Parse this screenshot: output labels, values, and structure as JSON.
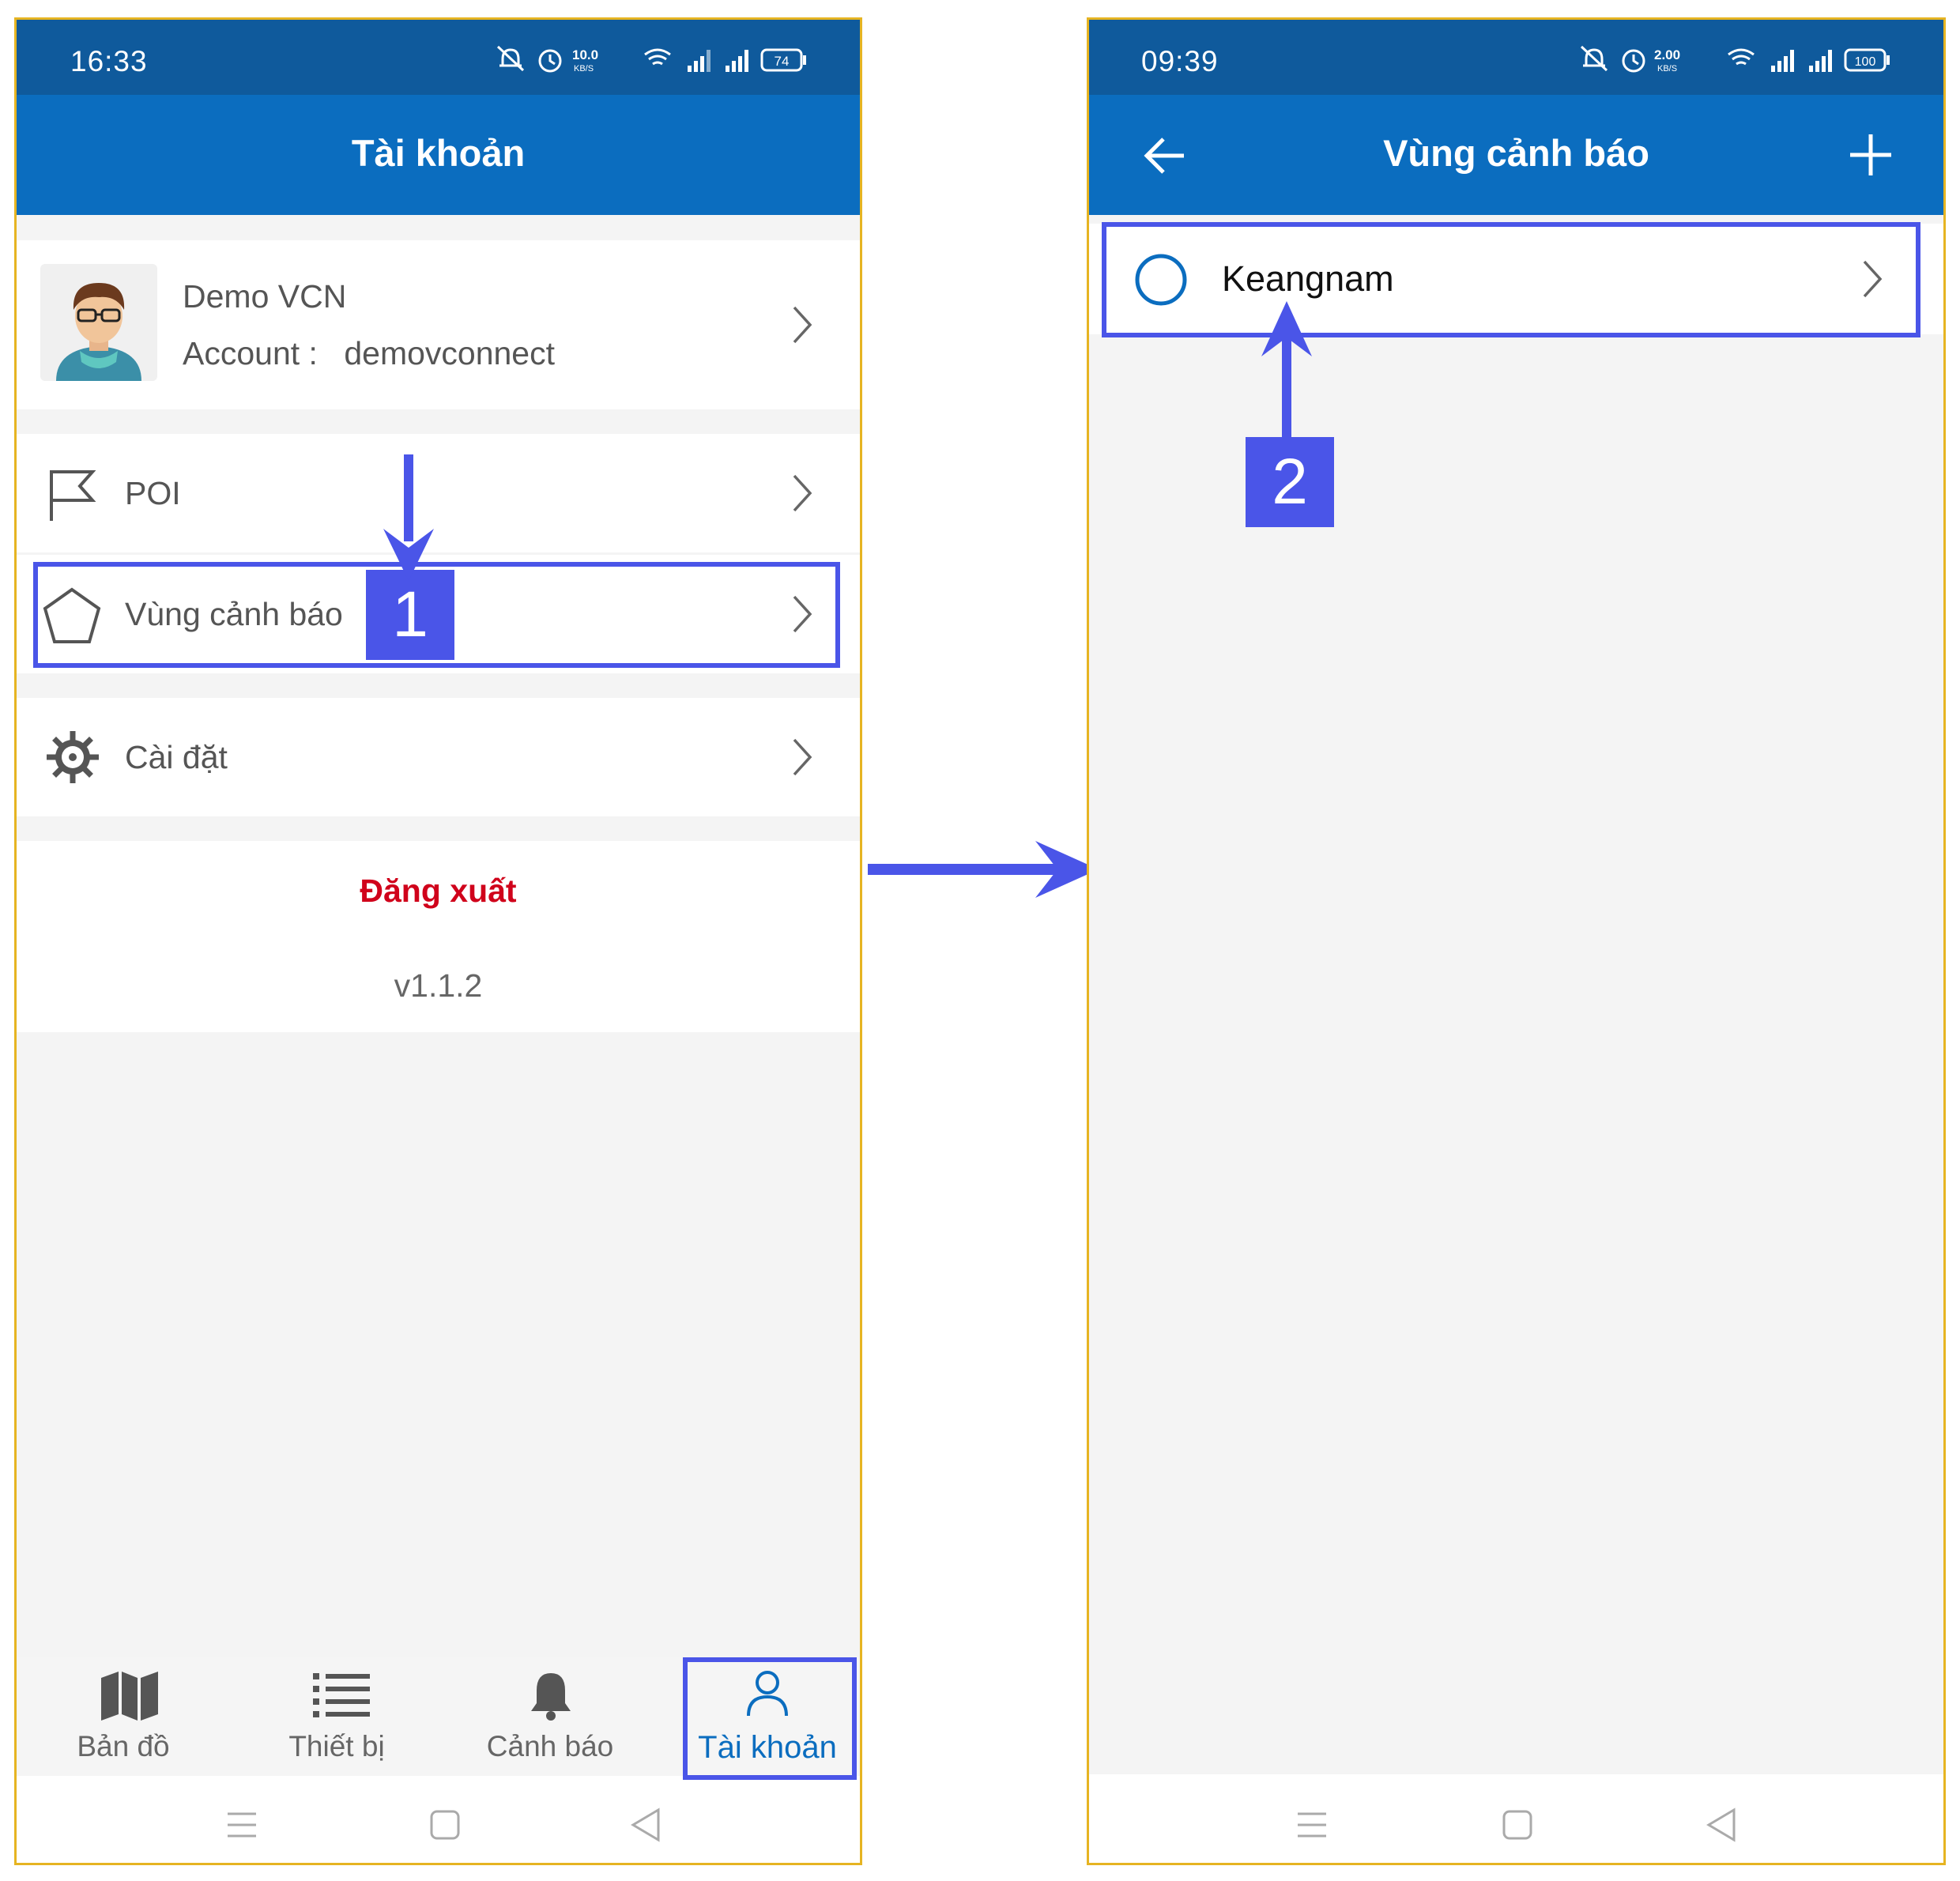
{
  "screen_left": {
    "status": {
      "time": "16:33",
      "net_speed_value": "10.0",
      "net_speed_unit": "KB/S",
      "battery": "74"
    },
    "header": {
      "title": "Tài khoản"
    },
    "profile": {
      "name": "Demo VCN",
      "account_label": "Account :",
      "account_value": "demovconnect"
    },
    "menu": [
      {
        "label": "POI"
      },
      {
        "label": "Vùng cảnh báo"
      },
      {
        "label": "Cài đặt"
      }
    ],
    "logout_label": "Đăng xuất",
    "version": "v1.1.2",
    "tabs": [
      {
        "label": "Bản đồ"
      },
      {
        "label": "Thiết bị"
      },
      {
        "label": "Cảnh báo"
      },
      {
        "label": "Tài khoản"
      }
    ],
    "step_badge": "1"
  },
  "screen_right": {
    "status": {
      "time": "09:39",
      "net_speed_value": "2.00",
      "net_speed_unit": "KB/S",
      "battery": "100"
    },
    "header": {
      "title": "Vùng cảnh báo"
    },
    "zones": [
      {
        "name": "Keangnam"
      }
    ],
    "step_badge": "2"
  },
  "colors": {
    "status_bar": "#0f5a9c",
    "app_bar": "#0b6dbf",
    "annotation": "#4a55e8",
    "logout": "#d0021b",
    "active_tab": "#0b6dbf",
    "frame": "#e6b422"
  }
}
